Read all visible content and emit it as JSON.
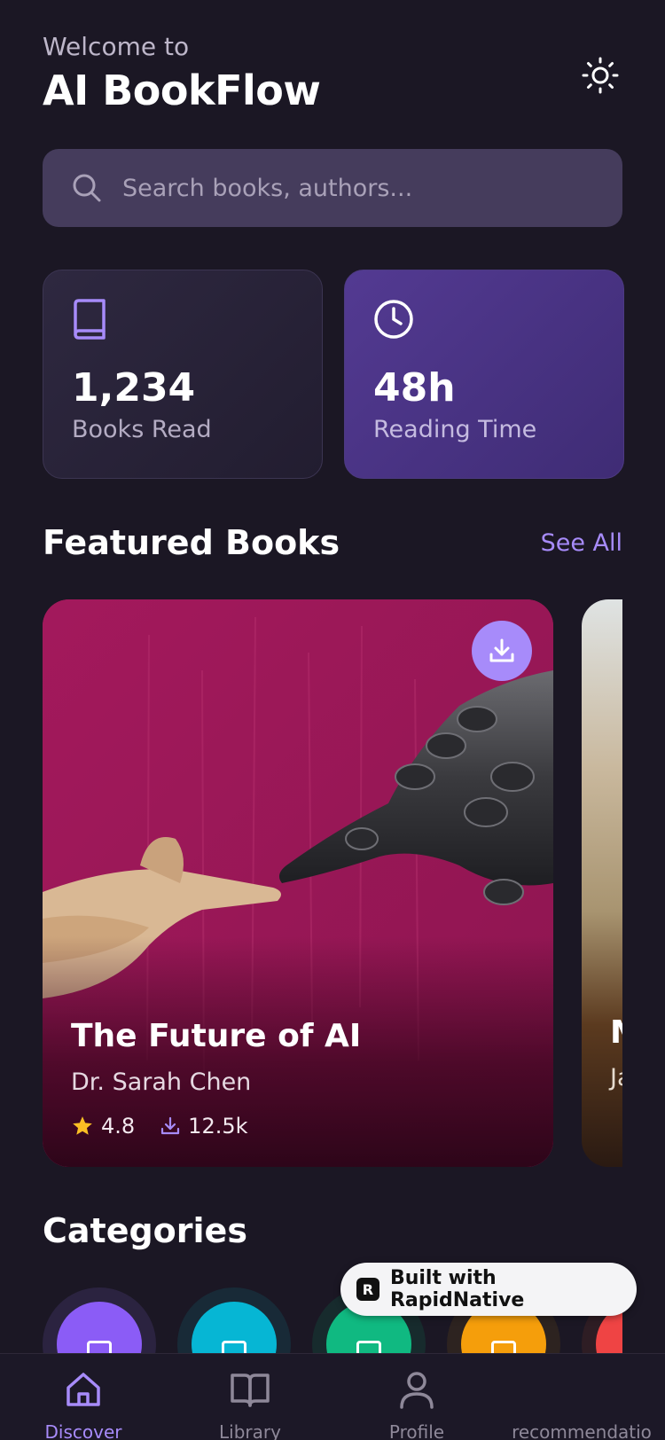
{
  "header": {
    "welcome": "Welcome to",
    "title": "AI BookFlow",
    "theme_icon": "sun-icon"
  },
  "search": {
    "placeholder": "Search books, authors..."
  },
  "stats": [
    {
      "value": "1,234",
      "label": "Books Read",
      "icon": "book-icon"
    },
    {
      "value": "48h",
      "label": "Reading Time",
      "icon": "clock-icon"
    }
  ],
  "featured": {
    "title": "Featured Books",
    "see_all": "See All",
    "books": [
      {
        "title": "The Future of AI",
        "author": "Dr. Sarah Chen",
        "rating": "4.8",
        "downloads": "12.5k"
      },
      {
        "title": "M",
        "author": "Ja"
      }
    ]
  },
  "categories": {
    "title": "Categories",
    "colors": [
      "#8b5cf6",
      "#06b6d4",
      "#10b981",
      "#f59e0b",
      "#ef4444"
    ]
  },
  "badge": {
    "text": "Built with RapidNative"
  },
  "tabs": [
    {
      "label": "Discover",
      "icon": "home-icon",
      "active": true
    },
    {
      "label": "Library",
      "icon": "open-book-icon",
      "active": false
    },
    {
      "label": "Profile",
      "icon": "person-icon",
      "active": false
    },
    {
      "label": "recommendatio",
      "icon": "",
      "active": false
    }
  ],
  "colors": {
    "background": "#1b1724",
    "accent": "#a78bfa",
    "card": "#a21a5a"
  }
}
